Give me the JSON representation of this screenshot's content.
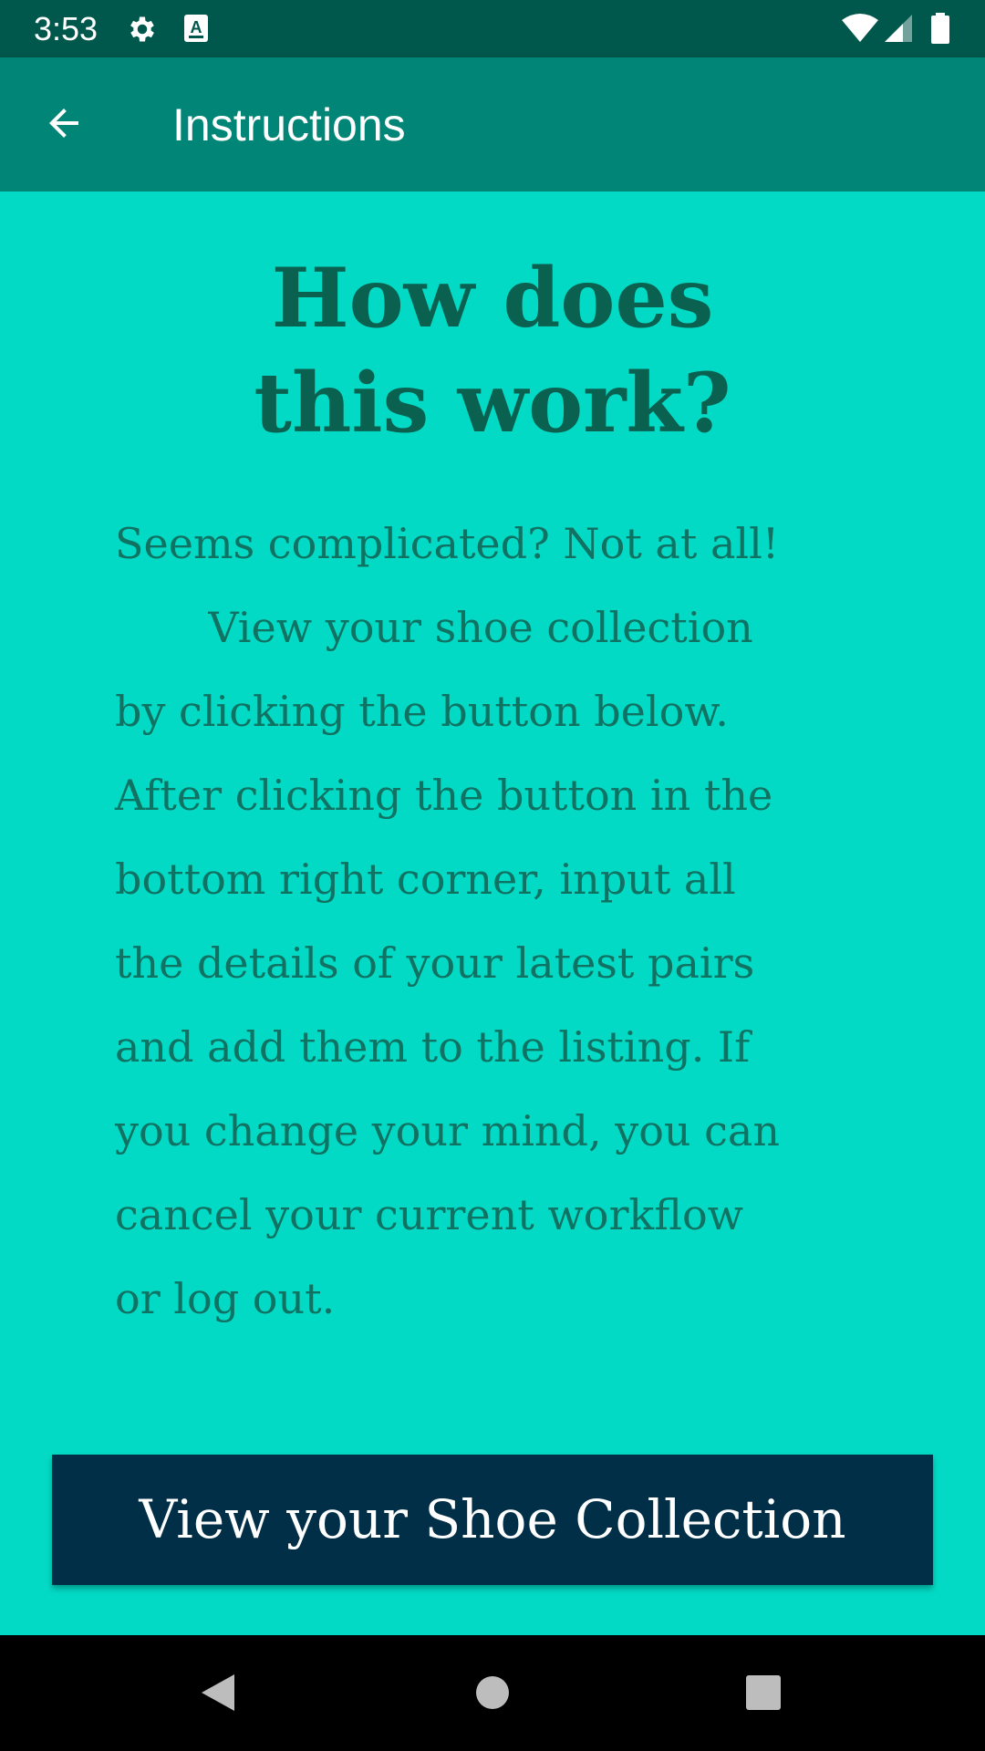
{
  "status_bar": {
    "time": "3:53",
    "icons": [
      "gear-icon",
      "keyboard-a-icon",
      "wifi-icon",
      "cell-signal-icon",
      "battery-icon"
    ]
  },
  "app_bar": {
    "back_icon": "arrow-back-icon",
    "title": "Instructions"
  },
  "main": {
    "headline": "How does\nthis work?",
    "body": "Seems complicated? Not at all!\n       View your shoe collection\nby clicking the button below.\nAfter clicking the button in the\nbottom right corner, input all\nthe details of your latest pairs\nand add them to the listing. If\nyou change your mind, you can\ncancel your current workflow\nor log out.",
    "button_label": "View your Shoe Collection"
  },
  "nav_bar": {
    "icons": [
      "back-triangle-icon",
      "home-circle-icon",
      "recents-square-icon"
    ]
  },
  "colors": {
    "status_bar": "#00574b",
    "app_bar": "#008577",
    "background": "#03dac5",
    "headline": "#0b6150",
    "body_text": "#0f7262",
    "button": "#002f47"
  }
}
